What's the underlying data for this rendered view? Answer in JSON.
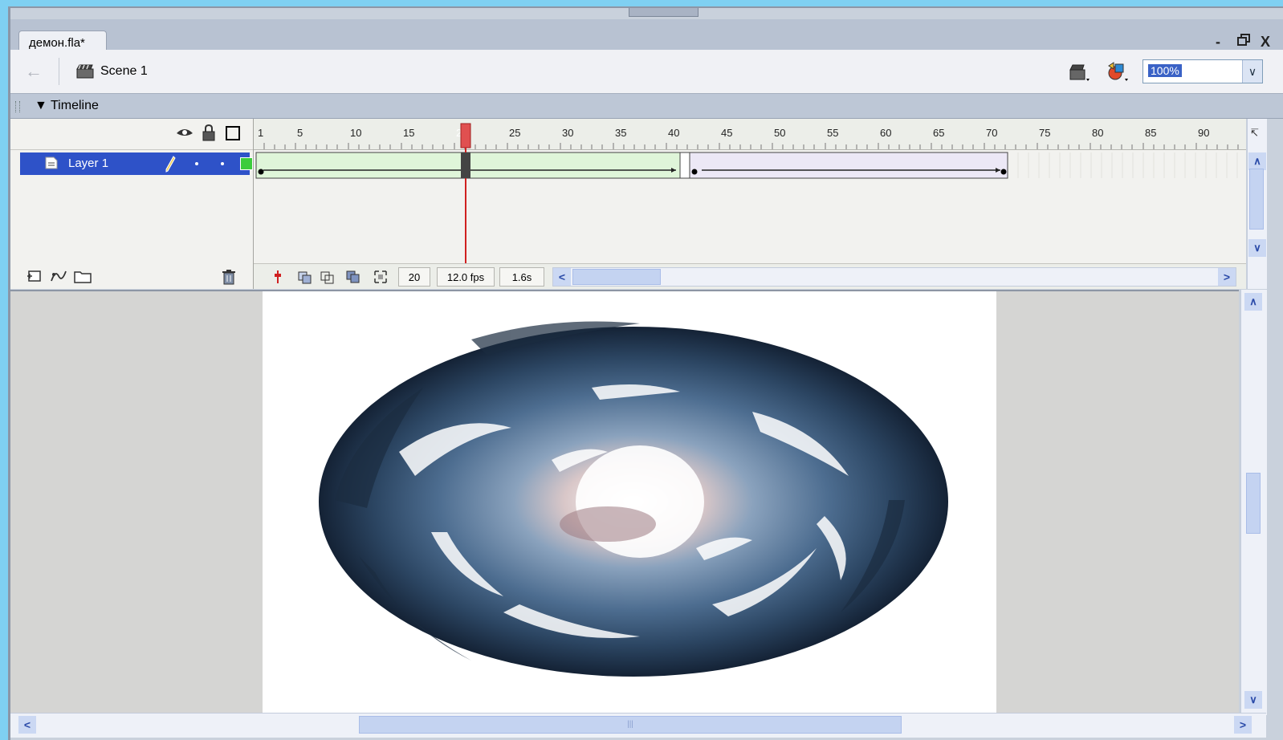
{
  "document": {
    "tab_title": "демон.fla*"
  },
  "window_controls": {
    "minimize": "-",
    "restore": "Ԑ",
    "close": "X"
  },
  "scene": {
    "name": "Scene 1"
  },
  "zoom": {
    "value": "100%"
  },
  "timeline": {
    "title": "Timeline",
    "ruler_ticks": [
      "1",
      "5",
      "10",
      "15",
      "20",
      "25",
      "30",
      "35",
      "40",
      "45",
      "50",
      "55",
      "60",
      "65",
      "70",
      "75",
      "80",
      "85",
      "90"
    ],
    "current_frame": "20",
    "frame_rate": "12.0 fps",
    "elapsed_time": "1.6s"
  },
  "layers": [
    {
      "name": "Layer 1",
      "color": "#3ccc3c"
    }
  ],
  "icons": {
    "back": "back-arrow-icon",
    "scene": "clapper-icon",
    "edit_scene": "edit-scene-icon",
    "edit_symbol": "edit-symbols-icon",
    "eye": "eye-icon",
    "lock": "lock-icon",
    "outline": "outline-icon",
    "trash": "trash-icon"
  }
}
